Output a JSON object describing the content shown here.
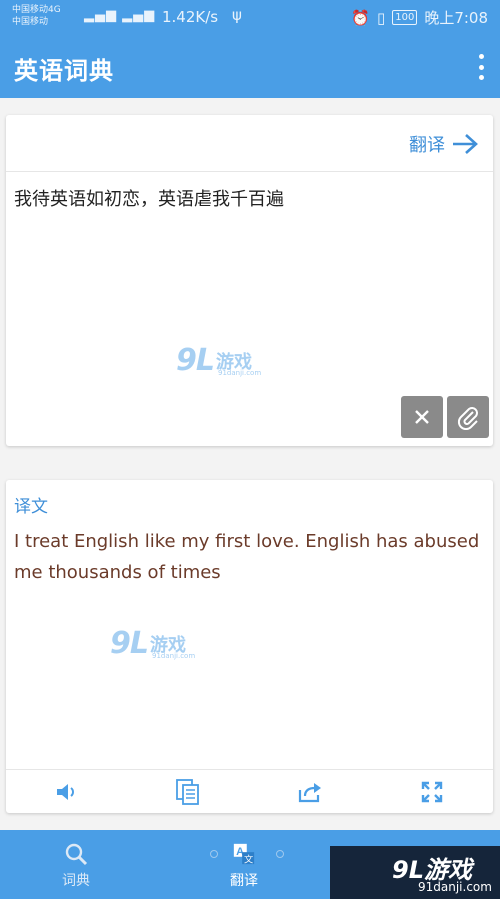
{
  "status_bar": {
    "carrier1": "中国移动4G",
    "carrier2": "中国移动",
    "network": "4G",
    "speed": "1.42K/s",
    "battery": "100",
    "time": "晚上7:08"
  },
  "app": {
    "title": "英语词典"
  },
  "input_card": {
    "translate_label": "翻译",
    "text": "我待英语如初恋，英语虐我千百遍"
  },
  "output_card": {
    "label": "译文",
    "text": "I treat English like my first love. English has abused me thousands of times"
  },
  "watermark": {
    "logo": "9L",
    "name": "游戏",
    "site": "91danji.com"
  },
  "bottom_nav": {
    "items": [
      {
        "label": "词典",
        "icon": "search-icon"
      },
      {
        "label": "翻译",
        "icon": "translate-icon"
      }
    ]
  },
  "corner_logo": {
    "main": "9L游戏",
    "site": "91danji.com"
  },
  "colors": {
    "primary": "#4a9ee6",
    "accent": "#3f8fd8",
    "output_text": "#6b3b2a"
  }
}
